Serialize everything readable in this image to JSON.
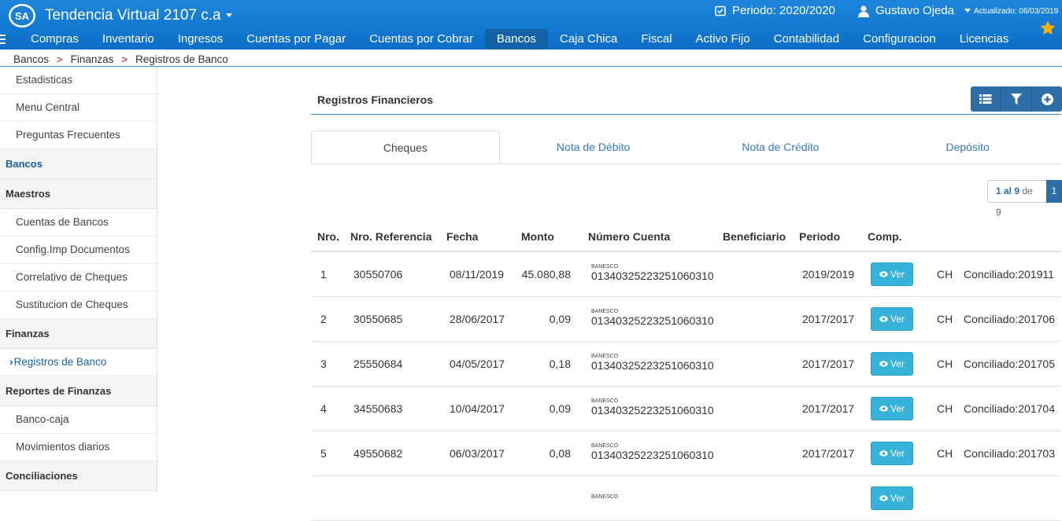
{
  "app": {
    "title": "Tendencia Virtual 2107 c.a",
    "logo_text": "SA"
  },
  "header": {
    "period": "Periodo: 2020/2020",
    "user": "Gustavo Ojeda",
    "updated": "Actualizado: 06/03/2019"
  },
  "nav": [
    "Compras",
    "Inventario",
    "Ingresos",
    "Cuentas por Pagar",
    "Cuentas por Cobrar",
    "Bancos",
    "Caja Chica",
    "Fiscal",
    "Activo Fijo",
    "Contabilidad",
    "Configuracion",
    "Licencias"
  ],
  "breadcrumb": [
    "Bancos",
    "Finanzas",
    "Registros de Banco"
  ],
  "sidebar": {
    "top": [
      "Estadisticas",
      "Menu Central",
      "Preguntas Frecuentes"
    ],
    "bancos": "Bancos",
    "maestros": {
      "title": "Maestros",
      "items": [
        "Cuentas de Bancos",
        "Config.Imp Documentos",
        "Correlativo de Cheques",
        "Sustitucion de Cheques"
      ]
    },
    "finanzas": {
      "title": "Finanzas",
      "items": [
        "Registros de Banco"
      ]
    },
    "reportes": {
      "title": "Reportes de Finanzas",
      "items": [
        "Banco-caja",
        "Movimientos diarios"
      ]
    },
    "conciliaciones": "Conciliaciones"
  },
  "panel": {
    "title": "Registros Financieros"
  },
  "tabs": [
    "Cheques",
    "Nota de Débito",
    "Nota de Crédito",
    "Depósito"
  ],
  "pager": {
    "range": "1 al 9",
    "of": "de 9",
    "page": "1"
  },
  "table": {
    "headers": [
      "Nro.",
      "Nro. Referencia",
      "Fecha",
      "Monto",
      "Número Cuenta",
      "Beneficiario",
      "Periodo",
      "Comp."
    ],
    "ver_label": "Ver",
    "rows": [
      {
        "nro": "1",
        "ref": "30550706",
        "fecha": "08/11/2019",
        "monto": "45.080,88",
        "banco": "BANESCO",
        "cuenta": "01340325223251060310",
        "beneficiario": "",
        "periodo": "2019/2019",
        "tipo": "CH",
        "estado": "Conciliado:201911"
      },
      {
        "nro": "2",
        "ref": "30550685",
        "fecha": "28/06/2017",
        "monto": "0,09",
        "banco": "BANESCO",
        "cuenta": "01340325223251060310",
        "beneficiario": "",
        "periodo": "2017/2017",
        "tipo": "CH",
        "estado": "Conciliado:201706"
      },
      {
        "nro": "3",
        "ref": "25550684",
        "fecha": "04/05/2017",
        "monto": "0,18",
        "banco": "BANESCO",
        "cuenta": "01340325223251060310",
        "beneficiario": "",
        "periodo": "2017/2017",
        "tipo": "CH",
        "estado": "Conciliado:201705"
      },
      {
        "nro": "4",
        "ref": "34550683",
        "fecha": "10/04/2017",
        "monto": "0,09",
        "banco": "BANESCO",
        "cuenta": "01340325223251060310",
        "beneficiario": "",
        "periodo": "2017/2017",
        "tipo": "CH",
        "estado": "Conciliado:201704"
      },
      {
        "nro": "5",
        "ref": "49550682",
        "fecha": "06/03/2017",
        "monto": "0,08",
        "banco": "BANESCO",
        "cuenta": "01340325223251060310",
        "beneficiario": "",
        "periodo": "2017/2017",
        "tipo": "CH",
        "estado": "Conciliado:201703"
      },
      {
        "nro": "",
        "ref": "",
        "fecha": "",
        "monto": "",
        "banco": "BANESCO",
        "cuenta": "",
        "beneficiario": "",
        "periodo": "",
        "tipo": "",
        "estado": ""
      }
    ]
  },
  "colors": {
    "topbar": "#0b6ec8",
    "nav_active": "#1361a6",
    "ver_button": "#37b2d9",
    "toolbar": "#2d6da8",
    "star": "#f5b400"
  },
  "icons": [
    "calendar-icon",
    "user-icon",
    "star-icon",
    "menu-icon",
    "list-icon",
    "filter-icon",
    "add-icon",
    "eye-icon",
    "chevron-right-icon"
  ]
}
